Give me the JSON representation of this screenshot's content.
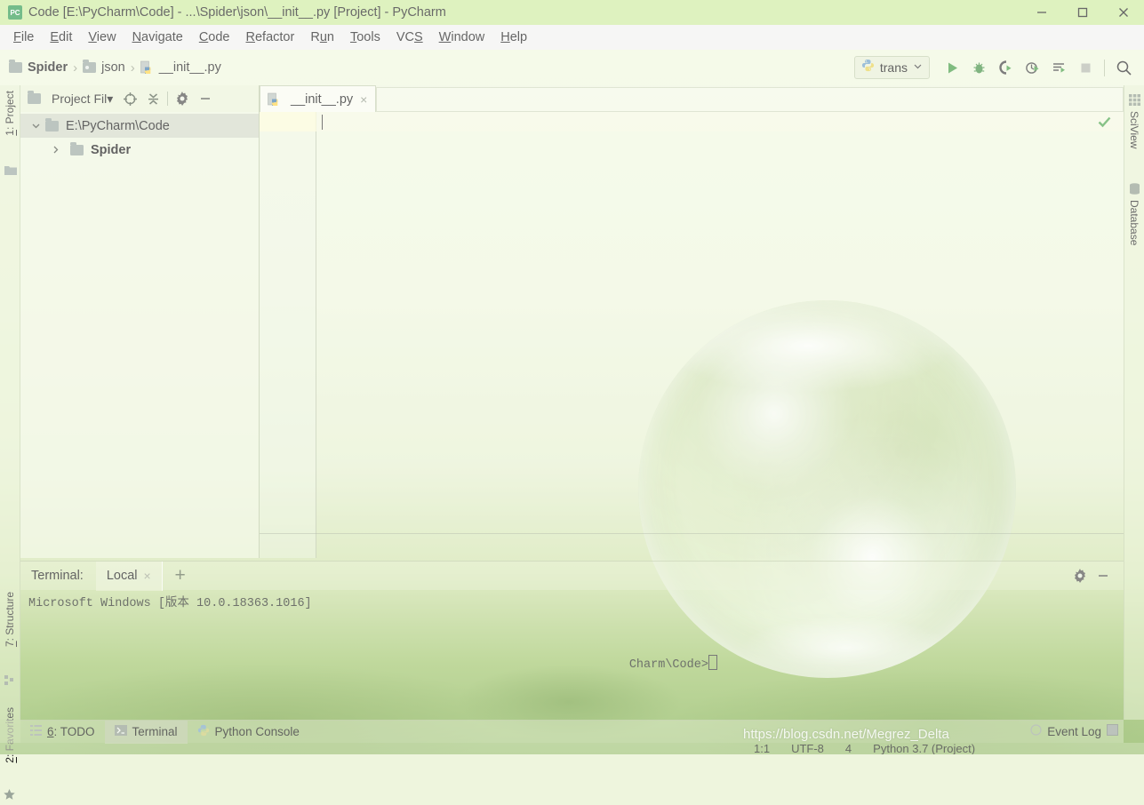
{
  "window": {
    "title": "Code [E:\\PyCharm\\Code] - ...\\Spider\\json\\__init__.py [Project] - PyCharm",
    "app_icon": "pycharm-icon",
    "controls": {
      "minimize": "minimize-icon",
      "maximize": "maximize-icon",
      "close": "close-icon"
    }
  },
  "menubar": {
    "items": [
      {
        "label": "File",
        "mnemonic": "F"
      },
      {
        "label": "Edit",
        "mnemonic": "E"
      },
      {
        "label": "View",
        "mnemonic": "V"
      },
      {
        "label": "Navigate",
        "mnemonic": "N"
      },
      {
        "label": "Code",
        "mnemonic": "C"
      },
      {
        "label": "Refactor",
        "mnemonic": "R"
      },
      {
        "label": "Run",
        "mnemonic": "u"
      },
      {
        "label": "Tools",
        "mnemonic": "T"
      },
      {
        "label": "VCS",
        "mnemonic": "S"
      },
      {
        "label": "Window",
        "mnemonic": "W"
      },
      {
        "label": "Help",
        "mnemonic": "H"
      }
    ]
  },
  "navbar": {
    "breadcrumbs": [
      {
        "label": "Spider",
        "icon": "folder-icon"
      },
      {
        "label": "json",
        "icon": "folder-package-icon"
      },
      {
        "label": "__init__.py",
        "icon": "python-file-icon"
      }
    ],
    "separator": "›",
    "run_config": {
      "label": "trans",
      "icon": "python-icon",
      "chevron": "chevron-down-icon"
    },
    "actions": [
      {
        "name": "run-button",
        "icon": "run-icon"
      },
      {
        "name": "debug-button",
        "icon": "debug-icon"
      },
      {
        "name": "run-coverage-button",
        "icon": "coverage-icon"
      },
      {
        "name": "profile-button",
        "icon": "profile-icon"
      },
      {
        "name": "run-with-options-button",
        "icon": "run-list-icon"
      },
      {
        "name": "stop-button",
        "icon": "stop-icon"
      },
      {
        "name": "search-everywhere-button",
        "icon": "search-icon"
      }
    ]
  },
  "left_strip": {
    "top_tabs": [
      {
        "label": "1: Project",
        "mnemonic": "1",
        "icon": "project-icon"
      }
    ],
    "bottom_tabs": [
      {
        "label": "7: Structure",
        "mnemonic": "7",
        "icon": "structure-icon"
      },
      {
        "label": "2: Favorites",
        "mnemonic": "2",
        "icon": "star-icon"
      }
    ]
  },
  "right_strip": {
    "tabs": [
      {
        "label": "SciView",
        "icon": "grid-icon"
      },
      {
        "label": "Database",
        "icon": "database-icon"
      }
    ]
  },
  "project_panel": {
    "title": "Project Fil",
    "title_suffix": "▾",
    "header_actions": [
      {
        "name": "select-opened-file-button",
        "icon": "target-icon"
      },
      {
        "name": "collapse-all-button",
        "icon": "collapse-all-icon"
      },
      {
        "name": "settings-button",
        "icon": "gear-icon"
      },
      {
        "name": "hide-button",
        "icon": "minimize-icon"
      }
    ],
    "tree": [
      {
        "label": "E:\\PyCharm\\Code",
        "icon": "folder-icon",
        "twisty": "⌄",
        "expanded": true,
        "selected": true,
        "bold": false,
        "indent": 0
      },
      {
        "label": "Spider",
        "icon": "folder-icon",
        "twisty": "›",
        "expanded": false,
        "selected": false,
        "bold": true,
        "indent": 1
      }
    ]
  },
  "editor": {
    "tabs": [
      {
        "label": "__init__.py",
        "icon": "python-file-icon",
        "close": "×",
        "active": true
      }
    ],
    "content": "",
    "inspection_status": "ok-checkmark-icon"
  },
  "terminal": {
    "label": "Terminal:",
    "tabs": [
      {
        "label": "Local",
        "close": "×",
        "active": true
      }
    ],
    "new_tab": "+",
    "actions": [
      {
        "name": "terminal-settings-button",
        "icon": "gear-icon"
      },
      {
        "name": "terminal-hide-button",
        "icon": "minimize-icon"
      }
    ],
    "lines": [
      "Microsoft Windows [版本 10.0.18363.1016]"
    ],
    "prompt": "Charm\\Code>",
    "cursor": true
  },
  "bottom_bar": {
    "items": [
      {
        "label": "6: TODO",
        "mnemonic": "6",
        "icon": "todo-icon",
        "active": false
      },
      {
        "label": "Terminal",
        "icon": "terminal-icon",
        "active": true
      },
      {
        "label": "Python Console",
        "icon": "python-icon",
        "active": false
      }
    ],
    "right_items": [
      {
        "label": "Event Log",
        "icon": "event-log-icon"
      }
    ]
  },
  "status_bar": {
    "caret_position": "1:1",
    "encoding": "UTF-8",
    "indent": "4",
    "interpreter": "Python 3.7 (Project)"
  },
  "watermark": "https://blog.csdn.net/Megrez_Delta",
  "colors": {
    "title_bg": "#cdeb9e",
    "menu_bg": "#f2f2f0",
    "accent_green": "#3c9a3c",
    "selection": "#c7cebe",
    "gutter_highlight": "#fffcd2"
  }
}
